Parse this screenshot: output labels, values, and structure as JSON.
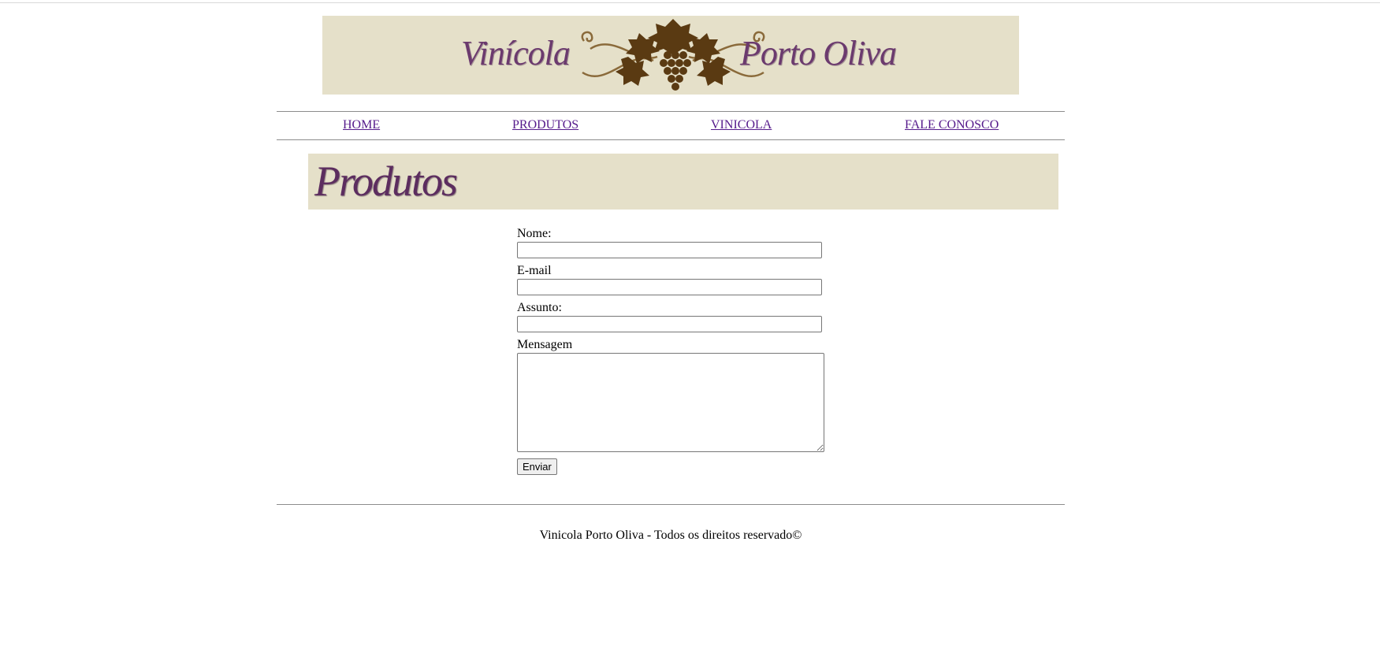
{
  "banner": {
    "left_text": "Vinícola",
    "right_text": "Porto Oliva",
    "background_color": "#e5e0c9",
    "text_color": "#6b3a6e",
    "emblem_icon": "grapevine-emblem-icon"
  },
  "nav": {
    "items": [
      {
        "label": "HOME"
      },
      {
        "label": "PRODUTOS"
      },
      {
        "label": "VINICOLA"
      },
      {
        "label": "FALE CONOSCO"
      }
    ],
    "link_color": "#551a8b"
  },
  "section": {
    "title": "Produtos"
  },
  "form": {
    "nome_label": "Nome:",
    "nome_value": "",
    "email_label": "E-mail",
    "email_value": "",
    "assunto_label": "Assunto:",
    "assunto_value": "",
    "mensagem_label": "Mensagem",
    "mensagem_value": "",
    "submit_label": "Enviar"
  },
  "footer": {
    "text": "Vinicola Porto Oliva - Todos os direitos reservado©"
  }
}
